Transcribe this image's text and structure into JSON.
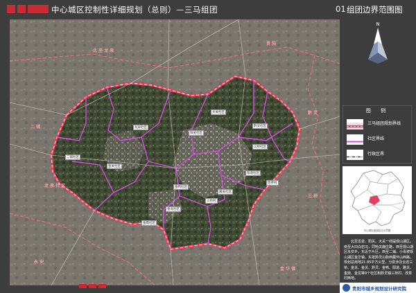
{
  "header": {
    "title": "中心城区控制性详细规划（总则）—三马组团",
    "number": "01",
    "sheet_title": "组团边界范围图"
  },
  "legend": {
    "title": "图 例",
    "items": [
      {
        "label": "三马组团规划界线"
      },
      {
        "label": "社区界线"
      },
      {
        "label": "行政区界"
      }
    ]
  },
  "description": "北至龙泉、阳关、大关一线提观山湖区，南至大凹白岩冯，同哈关鹿庄路，西至观山湖区永安乡，东近于片区，西至二铺，小青坡观山湖区金华镇，东抵黔灵山脉西麓环山西路，规划总用地21.85平方公里，分别涉及云岩三桥、金关、金关、黔灵、金鸭、阳道、雅关、金鼎、金龙等9个社区和黔灵镇三桥村、改茶村两地。",
  "inset": {
    "caption": "中心城区组团区位示意图"
  },
  "org": {
    "name": "贵阳市城乡规划设计研究院"
  },
  "map_labels": {
    "region_labels": [
      "北 至 龙 泉",
      "贵 阳",
      "二 铺",
      "黔 灵",
      "三 桥",
      "龙 泉 社 区",
      "永 安",
      "金 华 镇"
    ],
    "node_labels": [
      "龙泉社区",
      "阳关社区",
      "黔灵社区",
      "三桥社区",
      "金关社区",
      "金鸭社区",
      "阳道社区",
      "雅关社区",
      "金鼎社区",
      "金龙社区",
      "三桥村",
      "改茶村",
      "大关社区",
      "二铺社区"
    ]
  }
}
